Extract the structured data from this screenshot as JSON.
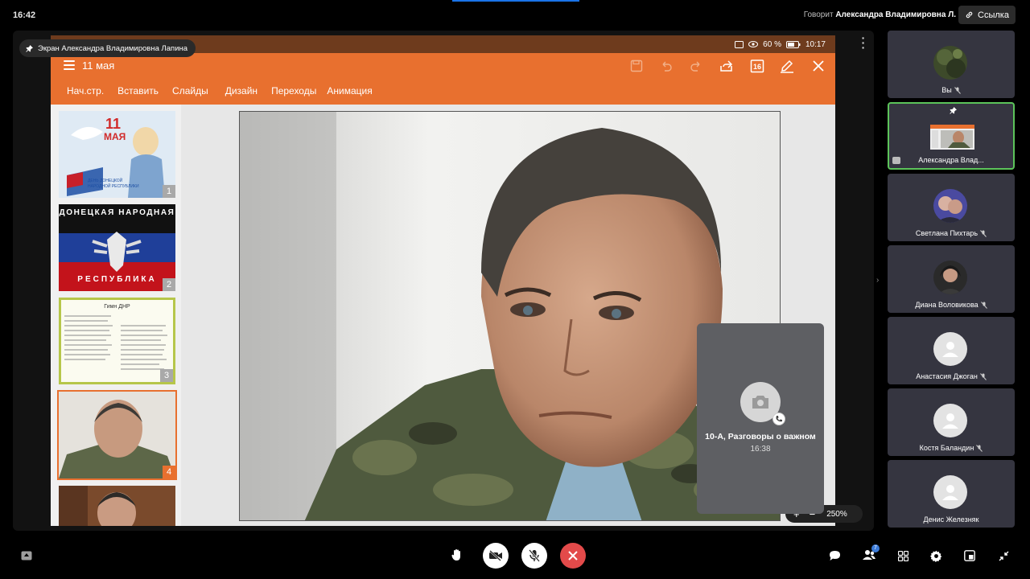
{
  "clock": "16:42",
  "speaker": {
    "prefix": "Говорит",
    "name": "Александра Владимировна Л."
  },
  "link_button": {
    "label": "Ссылка"
  },
  "share_label": "Экран Александра Владимировна Лапина",
  "phone_status": {
    "battery": "60 %",
    "time": "10:17"
  },
  "app": {
    "title": "11 мая",
    "calendar_day": "16",
    "tabs": [
      "Нач.стр.",
      "Вставить",
      "Слайды",
      "Дизайн",
      "Переходы",
      "Анимация"
    ]
  },
  "slides": [
    {
      "num": "1",
      "date": "11",
      "month": "МАЯ",
      "caption": "ДЕНЬ ДОНЕЦКОЙ НАРОДНОЙ РЕСПУБЛИКИ"
    },
    {
      "num": "2",
      "top": "ДОНЕЦКАЯ НАРОДНАЯ",
      "bottom": "РЕСПУБЛИКА"
    },
    {
      "num": "3",
      "title": "Гимн ДНР"
    },
    {
      "num": "4"
    },
    {
      "num": ""
    }
  ],
  "zoom": {
    "plus": "+",
    "minus": "−",
    "value": "250%"
  },
  "call_popup": {
    "name": "10-А, Разговоры о важном",
    "time": "16:38"
  },
  "participants": [
    {
      "name": "Вы"
    },
    {
      "name": "Александра Влад..."
    },
    {
      "name": "Светлана Пихтарь"
    },
    {
      "name": "Диана Воловикова"
    },
    {
      "name": "Анастасия Джоган"
    },
    {
      "name": "Костя Баландин"
    },
    {
      "name": "Денис Железняк"
    }
  ],
  "toolbar": {
    "participants_count": "7"
  },
  "colors": {
    "accent": "#e8702f",
    "selected": "#5cc45a",
    "end_call": "#e34a4a"
  }
}
